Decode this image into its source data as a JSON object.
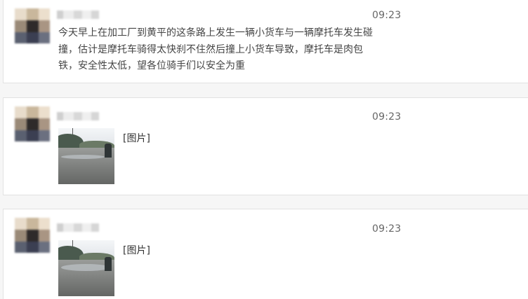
{
  "posts": [
    {
      "time": "09:23",
      "text": "今天早上在加工厂到黄平的这条路上发生一辆小货车与一辆摩托车发生碰撞，估计是摩托车骑得太快刹不住然后撞上小货车导致，摩托车是肉包铁，安全性太低，望各位骑手们以安全为重"
    },
    {
      "time": "09:23",
      "image_label": "[图片]"
    },
    {
      "time": "09:23",
      "image_label": "[图片]"
    }
  ],
  "colors": {
    "card_border": "#e2e2e2",
    "text": "#444444",
    "time": "#666666"
  }
}
